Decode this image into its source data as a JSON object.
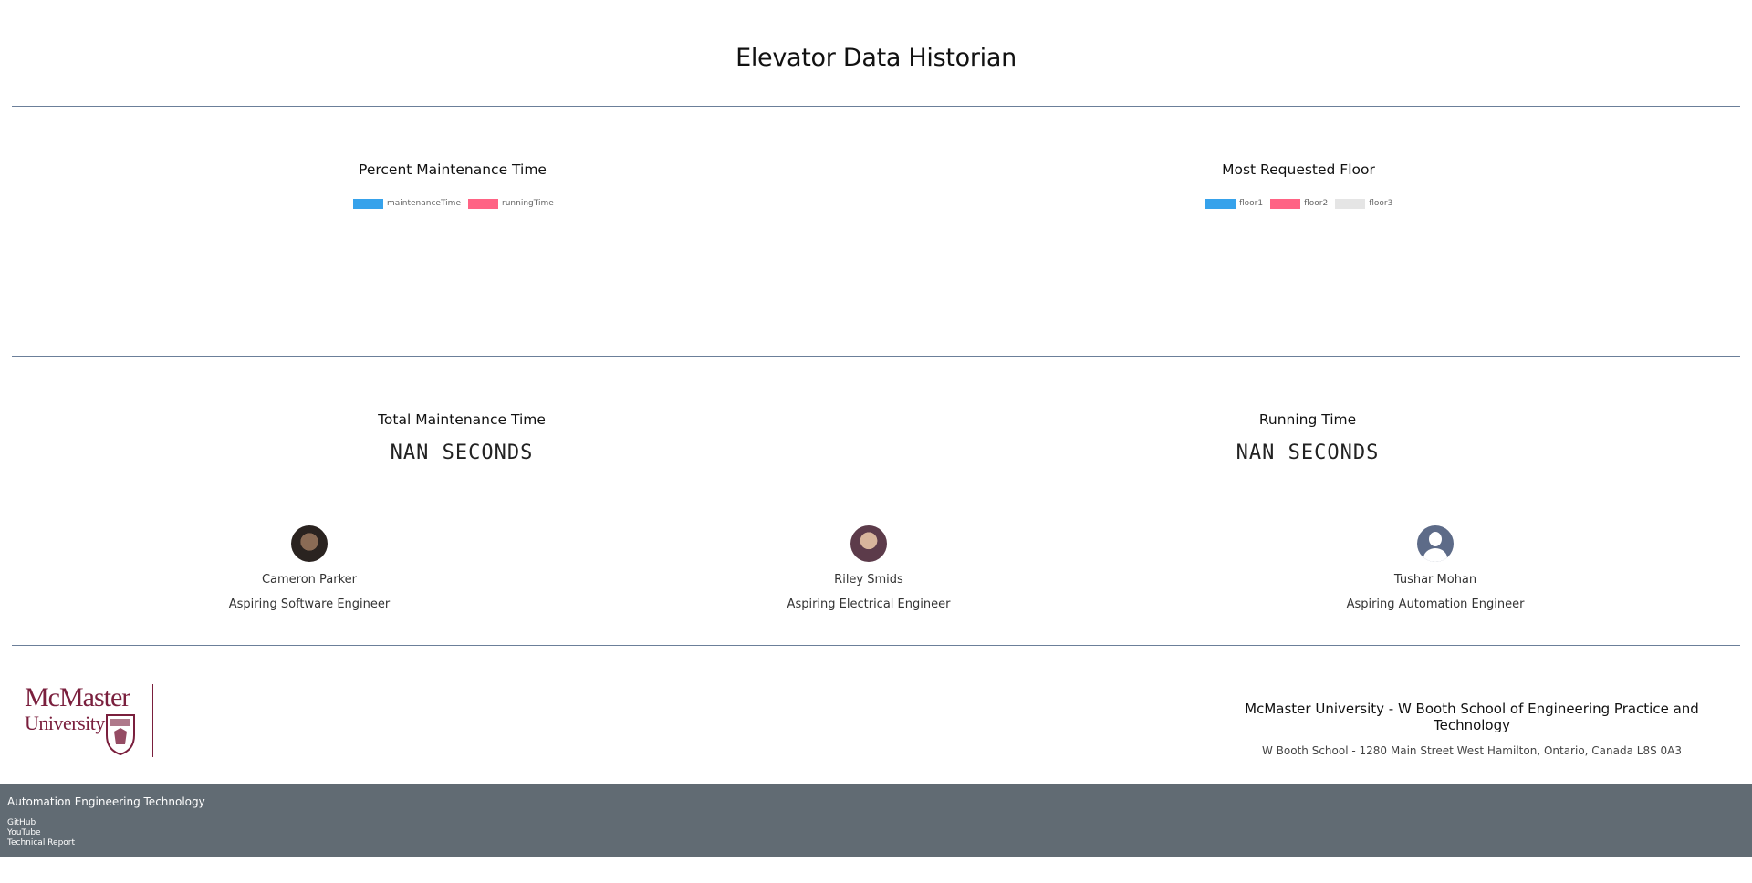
{
  "page": {
    "title": "Elevator Data Historian"
  },
  "charts": {
    "maintenance": {
      "title": "Percent Maintenance Time",
      "legend": [
        {
          "label": "maintenanceTime",
          "color": "#36a2eb"
        },
        {
          "label": "runningTime",
          "color": "#ff6384"
        }
      ]
    },
    "floors": {
      "title": "Most Requested Floor",
      "legend": [
        {
          "label": "floor1",
          "color": "#36a2eb"
        },
        {
          "label": "floor2",
          "color": "#ff6384"
        },
        {
          "label": "floor3",
          "color": "#e5e5e5"
        }
      ]
    }
  },
  "counters": {
    "maintenance": {
      "title": "Total Maintenance Time",
      "value": "NAN SECONDS"
    },
    "running": {
      "title": "Running Time",
      "value": "NAN SECONDS"
    }
  },
  "team": [
    {
      "name": "Cameron Parker",
      "role": "Aspiring Software Engineer",
      "avatar": "photo-dark"
    },
    {
      "name": "Riley Smids",
      "role": "Aspiring Electrical Engineer",
      "avatar": "photo-purple"
    },
    {
      "name": "Tushar Mohan",
      "role": "Aspiring Automation Engineer",
      "avatar": "placeholder-user-icon"
    }
  ],
  "footer": {
    "logo_line1": "McMaster",
    "logo_line2": "University",
    "school": "McMaster University - W Booth School of Engineering Practice and Technology",
    "address": "W Booth School - 1280 Main Street West Hamilton, Ontario, Canada L8S 0A3"
  },
  "bottom_bar": {
    "title": "Automation Engineering Technology",
    "links": [
      "GitHub",
      "YouTube",
      "Technical Report"
    ]
  }
}
